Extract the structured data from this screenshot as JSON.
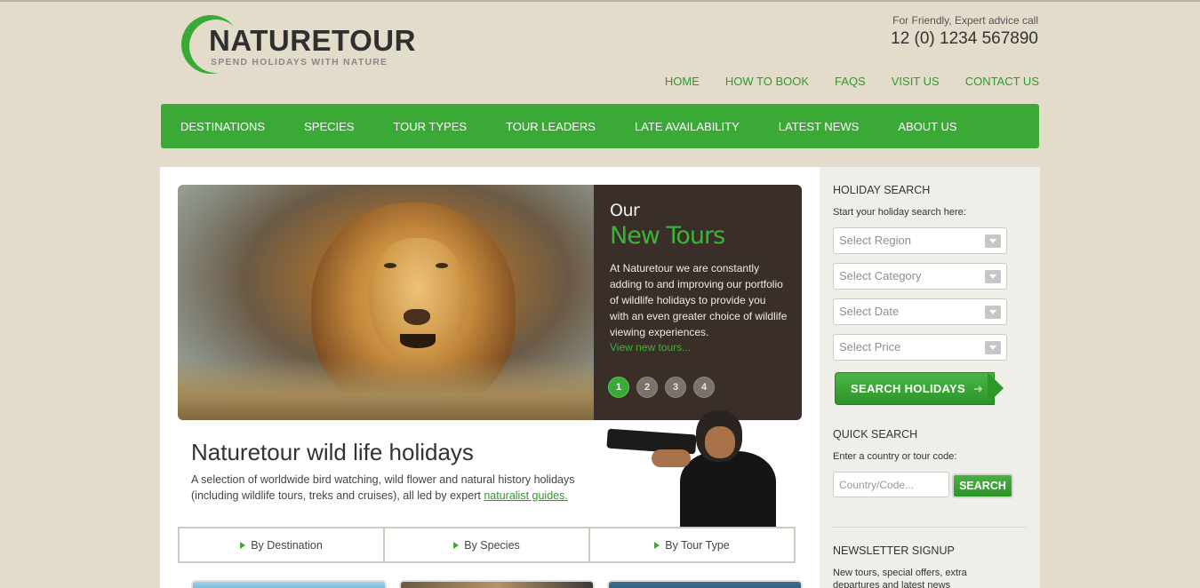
{
  "logo": {
    "name": "NATURETOUR",
    "tagline": "SPEND HOLIDAYS WITH NATURE"
  },
  "contact": {
    "label": "For Friendly, Expert advice call",
    "phone": "12 (0) 1234 567890"
  },
  "top_nav": [
    "HOME",
    "HOW TO BOOK",
    "FAQS",
    "VISIT US",
    "CONTACT US"
  ],
  "main_nav": [
    "DESTINATIONS",
    "SPECIES",
    "TOUR TYPES",
    "TOUR LEADERS",
    "LATE AVAILABILITY",
    "LATEST NEWS",
    "ABOUT US"
  ],
  "hero": {
    "title_small": "Our",
    "title_large": "New Tours",
    "text": "At Naturetour we are constantly adding to and improving our portfolio of wildlife holidays to provide you with an even greater choice of wildlife viewing experiences.",
    "link": "View new tours...",
    "slides": [
      "1",
      "2",
      "3",
      "4"
    ],
    "active_slide": 1
  },
  "intro": {
    "title": "Naturetour wild life holidays",
    "text": "A selection of worldwide bird watching, wild flower and natural history holidays (including wildlife tours, treks and cruises), all led by expert",
    "link": "naturalist guides."
  },
  "browse_tabs": [
    "By Destination",
    "By Species",
    "By Tour Type"
  ],
  "holiday_search": {
    "heading": "HOLIDAY SEARCH",
    "subtext": "Start your holiday search here:",
    "selects": [
      "Select Region",
      "Select Category",
      "Select Date",
      "Select Price"
    ],
    "button": "SEARCH HOLIDAYS"
  },
  "quick_search": {
    "heading": "QUICK SEARCH",
    "subtext": "Enter a country or tour code:",
    "placeholder": "Country/Code...",
    "button": "SEARCH"
  },
  "newsletter": {
    "heading": "NEWSLETTER SIGNUP",
    "text": "New tours, special offers, extra departures and latest news"
  },
  "colors": {
    "brand_green": "#3aa935",
    "background": "#e3dccb",
    "hero_panel": "#3a2f28"
  }
}
